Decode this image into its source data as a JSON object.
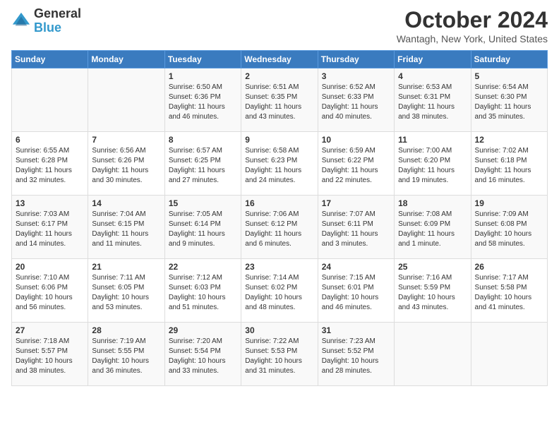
{
  "header": {
    "logo_general": "General",
    "logo_blue": "Blue",
    "month_title": "October 2024",
    "location": "Wantagh, New York, United States"
  },
  "days_of_week": [
    "Sunday",
    "Monday",
    "Tuesday",
    "Wednesday",
    "Thursday",
    "Friday",
    "Saturday"
  ],
  "weeks": [
    {
      "cells": [
        {
          "day": "",
          "content": ""
        },
        {
          "day": "",
          "content": ""
        },
        {
          "day": "1",
          "content": "Sunrise: 6:50 AM\nSunset: 6:36 PM\nDaylight: 11 hours and 46 minutes."
        },
        {
          "day": "2",
          "content": "Sunrise: 6:51 AM\nSunset: 6:35 PM\nDaylight: 11 hours and 43 minutes."
        },
        {
          "day": "3",
          "content": "Sunrise: 6:52 AM\nSunset: 6:33 PM\nDaylight: 11 hours and 40 minutes."
        },
        {
          "day": "4",
          "content": "Sunrise: 6:53 AM\nSunset: 6:31 PM\nDaylight: 11 hours and 38 minutes."
        },
        {
          "day": "5",
          "content": "Sunrise: 6:54 AM\nSunset: 6:30 PM\nDaylight: 11 hours and 35 minutes."
        }
      ]
    },
    {
      "cells": [
        {
          "day": "6",
          "content": "Sunrise: 6:55 AM\nSunset: 6:28 PM\nDaylight: 11 hours and 32 minutes."
        },
        {
          "day": "7",
          "content": "Sunrise: 6:56 AM\nSunset: 6:26 PM\nDaylight: 11 hours and 30 minutes."
        },
        {
          "day": "8",
          "content": "Sunrise: 6:57 AM\nSunset: 6:25 PM\nDaylight: 11 hours and 27 minutes."
        },
        {
          "day": "9",
          "content": "Sunrise: 6:58 AM\nSunset: 6:23 PM\nDaylight: 11 hours and 24 minutes."
        },
        {
          "day": "10",
          "content": "Sunrise: 6:59 AM\nSunset: 6:22 PM\nDaylight: 11 hours and 22 minutes."
        },
        {
          "day": "11",
          "content": "Sunrise: 7:00 AM\nSunset: 6:20 PM\nDaylight: 11 hours and 19 minutes."
        },
        {
          "day": "12",
          "content": "Sunrise: 7:02 AM\nSunset: 6:18 PM\nDaylight: 11 hours and 16 minutes."
        }
      ]
    },
    {
      "cells": [
        {
          "day": "13",
          "content": "Sunrise: 7:03 AM\nSunset: 6:17 PM\nDaylight: 11 hours and 14 minutes."
        },
        {
          "day": "14",
          "content": "Sunrise: 7:04 AM\nSunset: 6:15 PM\nDaylight: 11 hours and 11 minutes."
        },
        {
          "day": "15",
          "content": "Sunrise: 7:05 AM\nSunset: 6:14 PM\nDaylight: 11 hours and 9 minutes."
        },
        {
          "day": "16",
          "content": "Sunrise: 7:06 AM\nSunset: 6:12 PM\nDaylight: 11 hours and 6 minutes."
        },
        {
          "day": "17",
          "content": "Sunrise: 7:07 AM\nSunset: 6:11 PM\nDaylight: 11 hours and 3 minutes."
        },
        {
          "day": "18",
          "content": "Sunrise: 7:08 AM\nSunset: 6:09 PM\nDaylight: 11 hours and 1 minute."
        },
        {
          "day": "19",
          "content": "Sunrise: 7:09 AM\nSunset: 6:08 PM\nDaylight: 10 hours and 58 minutes."
        }
      ]
    },
    {
      "cells": [
        {
          "day": "20",
          "content": "Sunrise: 7:10 AM\nSunset: 6:06 PM\nDaylight: 10 hours and 56 minutes."
        },
        {
          "day": "21",
          "content": "Sunrise: 7:11 AM\nSunset: 6:05 PM\nDaylight: 10 hours and 53 minutes."
        },
        {
          "day": "22",
          "content": "Sunrise: 7:12 AM\nSunset: 6:03 PM\nDaylight: 10 hours and 51 minutes."
        },
        {
          "day": "23",
          "content": "Sunrise: 7:14 AM\nSunset: 6:02 PM\nDaylight: 10 hours and 48 minutes."
        },
        {
          "day": "24",
          "content": "Sunrise: 7:15 AM\nSunset: 6:01 PM\nDaylight: 10 hours and 46 minutes."
        },
        {
          "day": "25",
          "content": "Sunrise: 7:16 AM\nSunset: 5:59 PM\nDaylight: 10 hours and 43 minutes."
        },
        {
          "day": "26",
          "content": "Sunrise: 7:17 AM\nSunset: 5:58 PM\nDaylight: 10 hours and 41 minutes."
        }
      ]
    },
    {
      "cells": [
        {
          "day": "27",
          "content": "Sunrise: 7:18 AM\nSunset: 5:57 PM\nDaylight: 10 hours and 38 minutes."
        },
        {
          "day": "28",
          "content": "Sunrise: 7:19 AM\nSunset: 5:55 PM\nDaylight: 10 hours and 36 minutes."
        },
        {
          "day": "29",
          "content": "Sunrise: 7:20 AM\nSunset: 5:54 PM\nDaylight: 10 hours and 33 minutes."
        },
        {
          "day": "30",
          "content": "Sunrise: 7:22 AM\nSunset: 5:53 PM\nDaylight: 10 hours and 31 minutes."
        },
        {
          "day": "31",
          "content": "Sunrise: 7:23 AM\nSunset: 5:52 PM\nDaylight: 10 hours and 28 minutes."
        },
        {
          "day": "",
          "content": ""
        },
        {
          "day": "",
          "content": ""
        }
      ]
    }
  ]
}
